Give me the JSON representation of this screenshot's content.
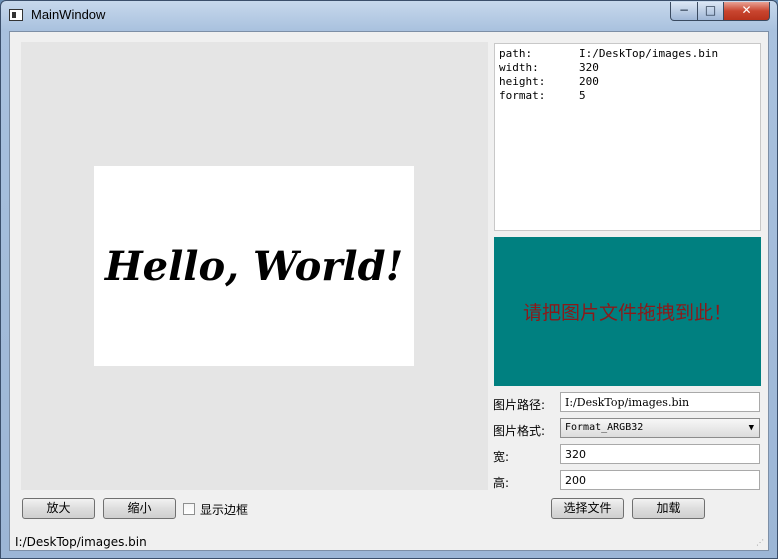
{
  "window": {
    "title": "MainWindow",
    "min_label": "−",
    "max_label": "□",
    "close_label": "✕"
  },
  "canvas": {
    "text": "Hello, World!"
  },
  "info": [
    {
      "key": "path:",
      "value": "I:/DeskTop/images.bin"
    },
    {
      "key": "width:",
      "value": "320"
    },
    {
      "key": "height:",
      "value": "200"
    },
    {
      "key": "format:",
      "value": "5"
    }
  ],
  "dropzone": {
    "text": "请把图片文件拖拽到此！",
    "bg_color": "#008080",
    "text_color": "#8b1a1a"
  },
  "form": {
    "path_label": "图片路径:",
    "path_value": "I:/DeskTop/images.bin",
    "format_label": "图片格式:",
    "format_value": "Format_ARGB32",
    "width_label": "宽:",
    "width_value": "320",
    "height_label": "高:",
    "height_value": "200"
  },
  "buttons": {
    "zoom_in": "放大",
    "zoom_out": "缩小",
    "show_border": "显示边框",
    "select_file": "选择文件",
    "load": "加载"
  },
  "status": {
    "text": "I:/DeskTop/images.bin"
  }
}
